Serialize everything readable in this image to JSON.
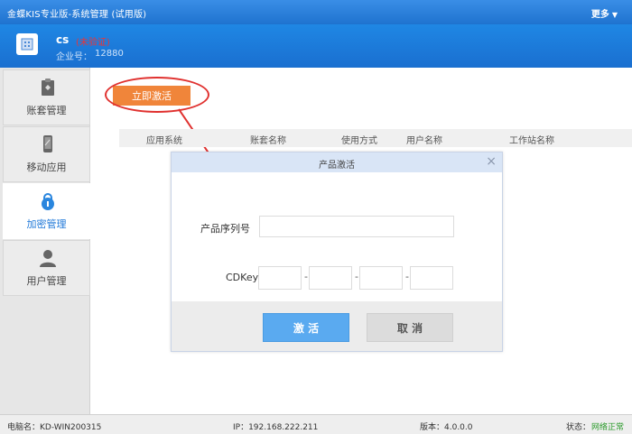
{
  "window": {
    "title": "金蝶KIS专业版-系统管理 (试用版)",
    "more_label": "更多",
    "more_icon": "caret-down-icon"
  },
  "header": {
    "org_name": "cs",
    "org_badge": "(未验证)",
    "org_id_label": "企业号：",
    "org_id": "12880"
  },
  "sidebar": {
    "items": [
      {
        "label": "账套管理",
        "icon": "clipboard-icon",
        "active": false
      },
      {
        "label": "移动应用",
        "icon": "mobile-icon",
        "active": false
      },
      {
        "label": "加密管理",
        "icon": "lock-icon",
        "active": true
      },
      {
        "label": "用户管理",
        "icon": "user-icon",
        "active": false
      }
    ]
  },
  "main": {
    "activate_label": "立即激活",
    "table_headers": [
      "应用系统",
      "账套名称",
      "使用方式",
      "用户名称",
      "工作站名称"
    ]
  },
  "dialog": {
    "title": "产品激活",
    "close_icon": "close-icon",
    "serial_label": "产品序列号",
    "serial_value": "",
    "cdkey_label": "CDKey",
    "cdkey_separator": "-",
    "ok_label": "激 活",
    "cancel_label": "取 消"
  },
  "statusbar": {
    "computer_label": "电脑名：KD-WIN200315",
    "ip_label": "IP：192.168.222.211",
    "version_label": "版本：4.0.0.0",
    "status_label": "状态：",
    "status_value": "网络正常"
  },
  "colors": {
    "accent": "#1f73cf",
    "activate": "#f0853a",
    "highlight": "#e0312f",
    "status_ok": "#2a9a2a"
  }
}
